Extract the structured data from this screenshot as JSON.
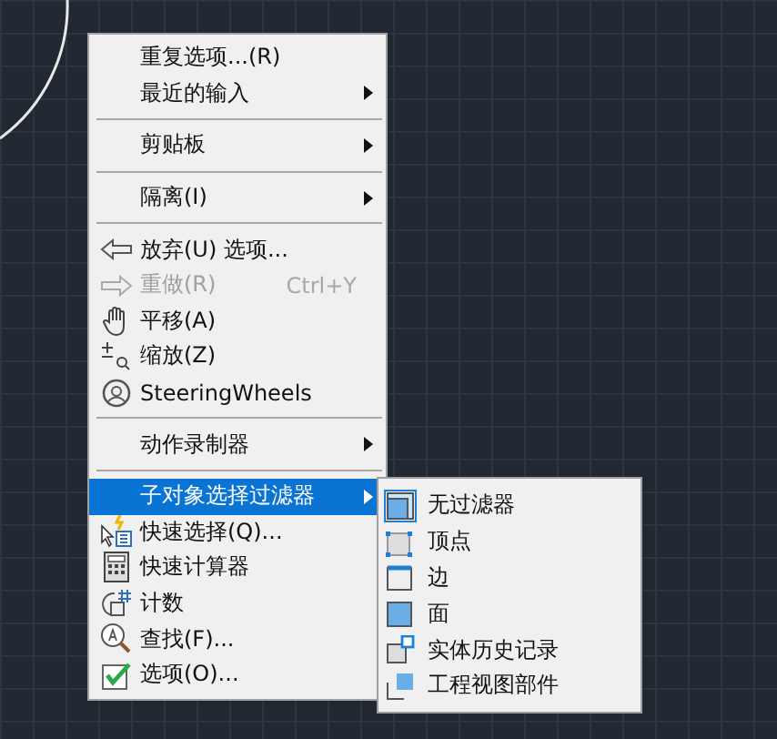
{
  "context_menu": {
    "items": [
      {
        "kind": "item",
        "label": "重复选项...(R)",
        "submenu": false,
        "disabled": false,
        "selected": false
      },
      {
        "kind": "item",
        "label": "最近的输入",
        "submenu": true,
        "disabled": false,
        "selected": false
      },
      {
        "kind": "separator"
      },
      {
        "kind": "item",
        "label": "剪贴板",
        "submenu": true,
        "disabled": false,
        "selected": false
      },
      {
        "kind": "separator"
      },
      {
        "kind": "item",
        "label": "隔离(I)",
        "submenu": true,
        "disabled": false,
        "selected": false
      },
      {
        "kind": "separator"
      },
      {
        "kind": "item",
        "label": "放弃(U) 选项...",
        "submenu": false,
        "disabled": false,
        "selected": false
      },
      {
        "kind": "item",
        "label": "重做(R)",
        "shortcut": "Ctrl+Y",
        "submenu": false,
        "disabled": true,
        "selected": false
      },
      {
        "kind": "item",
        "label": "平移(A)",
        "submenu": false,
        "disabled": false,
        "selected": false
      },
      {
        "kind": "item",
        "label": "缩放(Z)",
        "submenu": false,
        "disabled": false,
        "selected": false
      },
      {
        "kind": "item",
        "label": "SteeringWheels",
        "submenu": false,
        "disabled": false,
        "selected": false
      },
      {
        "kind": "separator"
      },
      {
        "kind": "item",
        "label": "动作录制器",
        "submenu": true,
        "disabled": false,
        "selected": false
      },
      {
        "kind": "separator"
      },
      {
        "kind": "item",
        "label": "子对象选择过滤器",
        "submenu": true,
        "disabled": false,
        "selected": true
      },
      {
        "kind": "item",
        "label": "快速选择(Q)...",
        "submenu": false,
        "disabled": false,
        "selected": false
      },
      {
        "kind": "item",
        "label": "快速计算器",
        "submenu": false,
        "disabled": false,
        "selected": false
      },
      {
        "kind": "item",
        "label": "计数",
        "submenu": false,
        "disabled": false,
        "selected": false
      },
      {
        "kind": "item",
        "label": "查找(F)...",
        "submenu": false,
        "disabled": false,
        "selected": false
      },
      {
        "kind": "item",
        "label": "选项(O)...",
        "submenu": false,
        "disabled": false,
        "selected": false
      }
    ]
  },
  "submenu": {
    "items": [
      {
        "label": "无过滤器",
        "selected": true
      },
      {
        "label": "顶点",
        "selected": false
      },
      {
        "label": "边",
        "selected": false
      },
      {
        "label": "面",
        "selected": false
      },
      {
        "label": "实体历史记录",
        "selected": false
      },
      {
        "label": "工程视图部件",
        "selected": false
      }
    ]
  }
}
